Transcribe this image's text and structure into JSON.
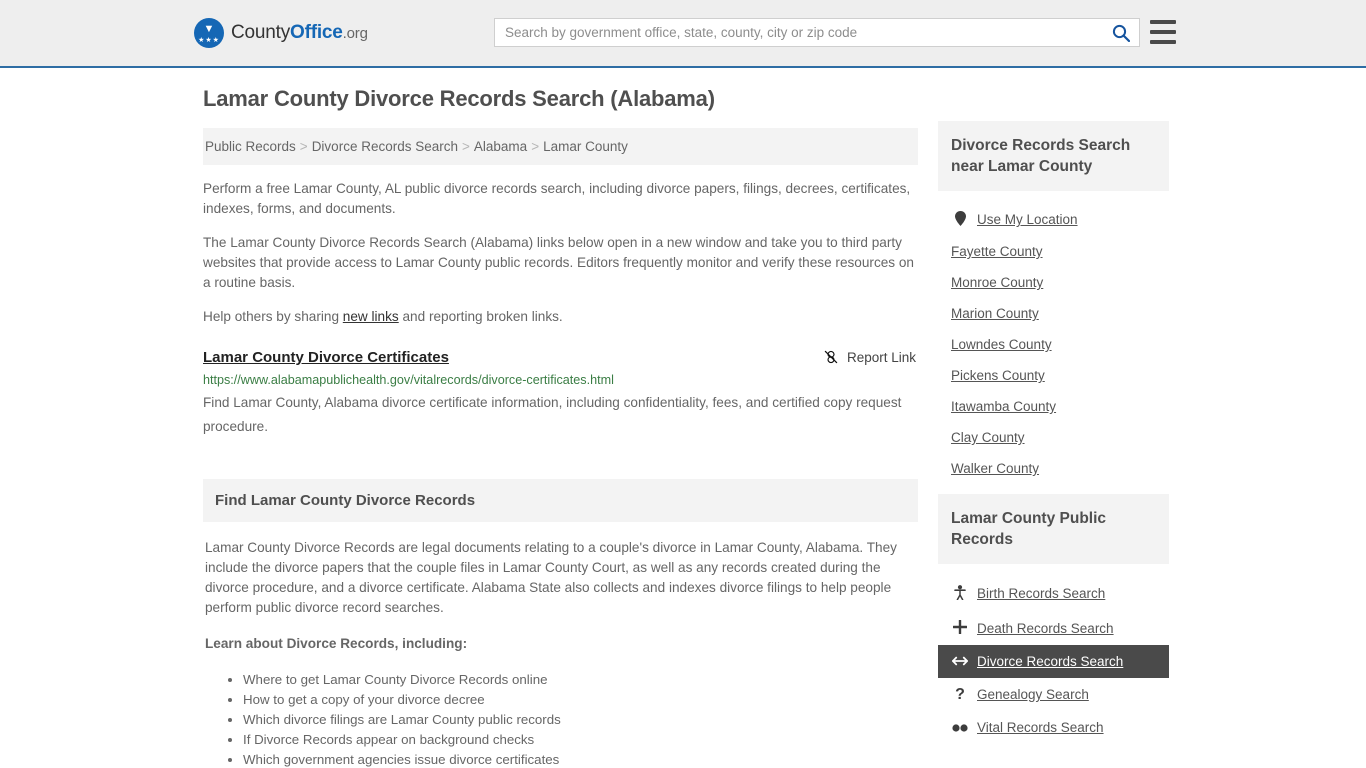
{
  "header": {
    "logo": {
      "part1": "County",
      "part2": "Office",
      "part3": ".org",
      "icon": "eagle-shield-icon"
    },
    "search": {
      "placeholder": "Search by government office, state, county, city or zip code",
      "value": "",
      "icon": "search-icon"
    },
    "menu_icon": "hamburger-menu-icon",
    "accent_color": "#2e6da4",
    "background_color": "#eeeeee"
  },
  "main": {
    "title": "Lamar County Divorce Records Search (Alabama)",
    "breadcrumb": [
      "Public Records",
      "Divorce Records Search",
      "Alabama",
      "Lamar County"
    ],
    "breadcrumb_separator": ">",
    "intro_paragraph": "Perform a free Lamar County, AL public divorce records search, including divorce papers, filings, decrees, certificates, indexes, forms, and documents.",
    "second_paragraph": "The Lamar County Divorce Records Search (Alabama) links below open in a new window and take you to third party websites that provide access to Lamar County public records. Editors frequently monitor and verify these resources on a routine basis.",
    "help_prefix": "Help others by sharing ",
    "help_link": "new links",
    "help_suffix": " and reporting broken links.",
    "result": {
      "title": "Lamar County Divorce Certificates",
      "report_label": "Report Link",
      "report_icon": "broken-link-icon",
      "url": "https://www.alabamapublichealth.gov/vitalrecords/divorce-certificates.html",
      "url_color": "#3a7d44",
      "description": "Find Lamar County, Alabama divorce certificate information, including confidentiality, fees, and certified copy request procedure."
    },
    "find_section": {
      "heading": "Find Lamar County Divorce Records",
      "paragraph": "Lamar County Divorce Records are legal documents relating to a couple's divorce in Lamar County, Alabama. They include the divorce papers that the couple files in Lamar County Court, as well as any records created during the divorce procedure, and a divorce certificate. Alabama State also collects and indexes divorce filings to help people perform public divorce record searches.",
      "learn_heading": "Learn about Divorce Records, including:",
      "learn_items": [
        "Where to get Lamar County Divorce Records online",
        "How to get a copy of your divorce decree",
        "Which divorce filings are Lamar County public records",
        "If Divorce Records appear on background checks",
        "Which government agencies issue divorce certificates"
      ]
    }
  },
  "sidebar": {
    "nearby": {
      "heading": "Divorce Records Search near Lamar County",
      "items": [
        {
          "label": "Use My Location",
          "icon": "map-pin-icon"
        },
        {
          "label": "Fayette County",
          "icon": ""
        },
        {
          "label": "Monroe County",
          "icon": ""
        },
        {
          "label": "Marion County",
          "icon": ""
        },
        {
          "label": "Lowndes County",
          "icon": ""
        },
        {
          "label": "Pickens County",
          "icon": ""
        },
        {
          "label": "Itawamba County",
          "icon": ""
        },
        {
          "label": "Clay County",
          "icon": ""
        },
        {
          "label": "Walker County",
          "icon": ""
        }
      ]
    },
    "public_records": {
      "heading": "Lamar County Public Records",
      "active_index": 2,
      "active_color": "#4a4a4a",
      "items": [
        {
          "label": "Birth Records Search",
          "icon": "baby-icon"
        },
        {
          "label": "Death Records Search",
          "icon": "cross-icon"
        },
        {
          "label": "Divorce Records Search",
          "icon": "left-right-arrow-icon"
        },
        {
          "label": "Genealogy Search",
          "icon": "question-mark-icon"
        },
        {
          "label": "Vital Records Search",
          "icon": "binoculars-icon"
        }
      ]
    }
  }
}
